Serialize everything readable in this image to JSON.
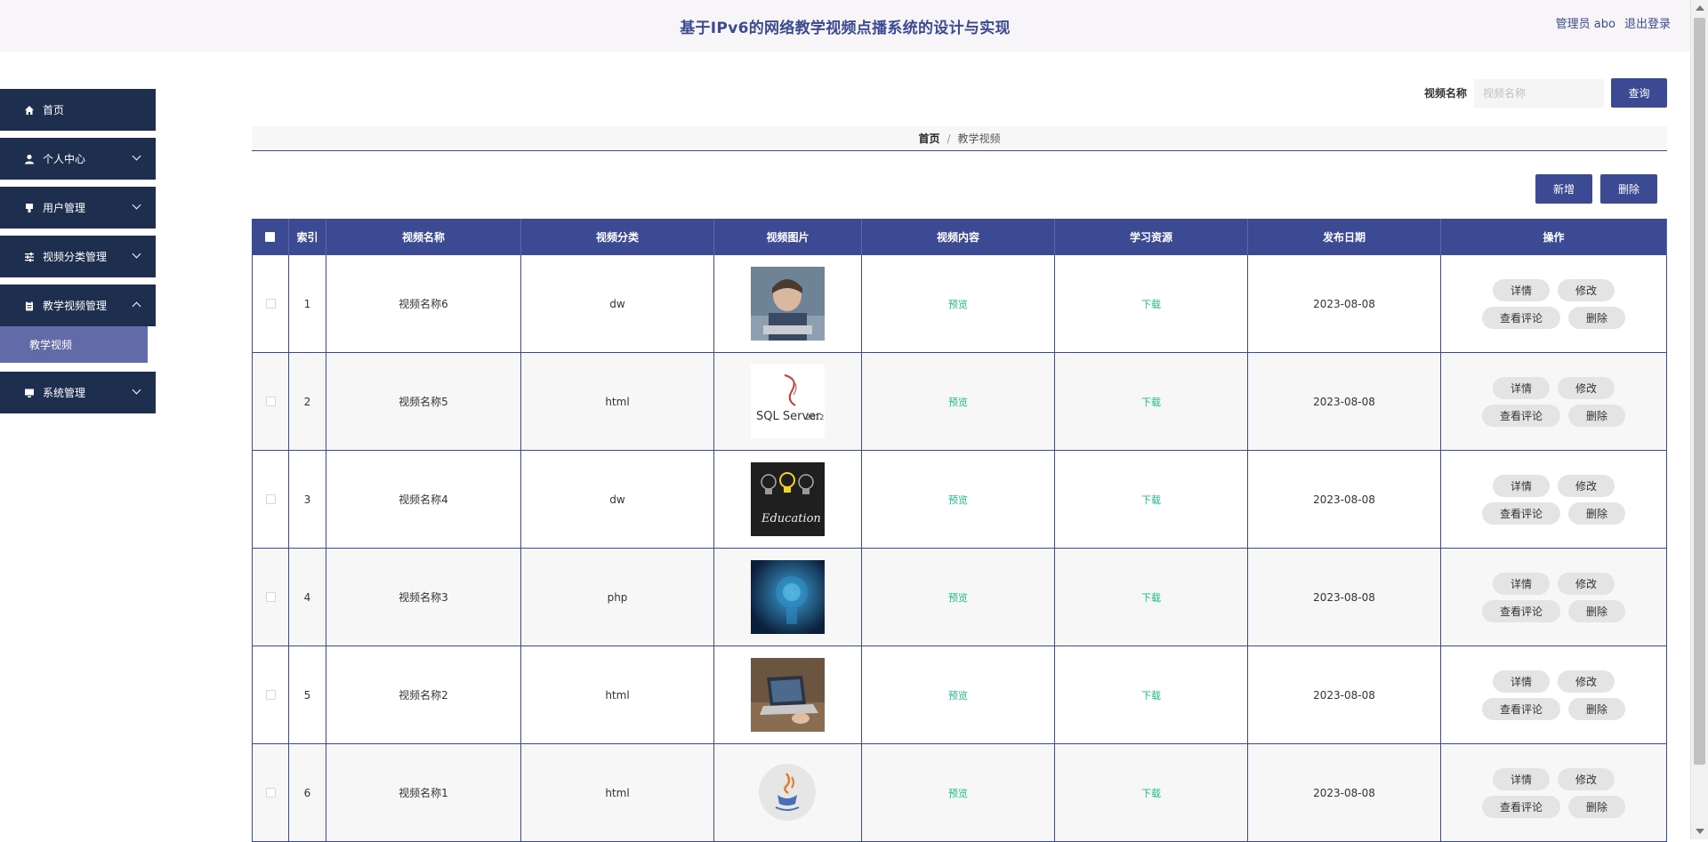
{
  "header": {
    "title": "基于IPv6的网络教学视频点播系统的设计与实现",
    "user": "管理员 abo",
    "logout": "退出登录"
  },
  "sidebar": {
    "items": [
      {
        "label": "首页",
        "icon": "home-icon"
      },
      {
        "label": "个人中心",
        "icon": "user-icon"
      },
      {
        "label": "用户管理",
        "icon": "users-icon"
      },
      {
        "label": "视频分类管理",
        "icon": "sliders-icon"
      },
      {
        "label": "教学视频管理",
        "icon": "clipboard-icon"
      },
      {
        "label": "系统管理",
        "icon": "monitor-icon"
      }
    ],
    "submenu": {
      "label": "教学视频"
    }
  },
  "search": {
    "label": "视频名称",
    "placeholder": "视频名称",
    "button": "查询"
  },
  "breadcrumb": {
    "home": "首页",
    "separator": "/",
    "current": "教学视频"
  },
  "actions": {
    "add": "新增",
    "delete": "删除"
  },
  "table": {
    "headers": [
      "",
      "索引",
      "视频名称",
      "视频分类",
      "视频图片",
      "视频内容",
      "学习资源",
      "发布日期",
      "操作"
    ],
    "rows": [
      {
        "index": "1",
        "name": "视频名称6",
        "category": "dw",
        "content": "预览",
        "resource": "下载",
        "date": "2023-08-08"
      },
      {
        "index": "2",
        "name": "视频名称5",
        "category": "html",
        "content": "预览",
        "resource": "下载",
        "date": "2023-08-08"
      },
      {
        "index": "3",
        "name": "视频名称4",
        "category": "dw",
        "content": "预览",
        "resource": "下载",
        "date": "2023-08-08"
      },
      {
        "index": "4",
        "name": "视频名称3",
        "category": "php",
        "content": "预览",
        "resource": "下载",
        "date": "2023-08-08"
      },
      {
        "index": "5",
        "name": "视频名称2",
        "category": "html",
        "content": "预览",
        "resource": "下载",
        "date": "2023-08-08"
      },
      {
        "index": "6",
        "name": "视频名称1",
        "category": "html",
        "content": "预览",
        "resource": "下载",
        "date": "2023-08-08"
      }
    ],
    "ops": {
      "detail": "详情",
      "edit": "修改",
      "comments": "查看评论",
      "delete": "删除"
    }
  },
  "images": {
    "thumb_sql_text": "SQL Server",
    "thumb_sql_year": "2012",
    "thumb_edu_text": "Education"
  },
  "colors": {
    "primary": "#3c4a94",
    "sidebar": "#1e2e4e",
    "submenu": "#636aa8",
    "link": "#1ebb8c"
  }
}
